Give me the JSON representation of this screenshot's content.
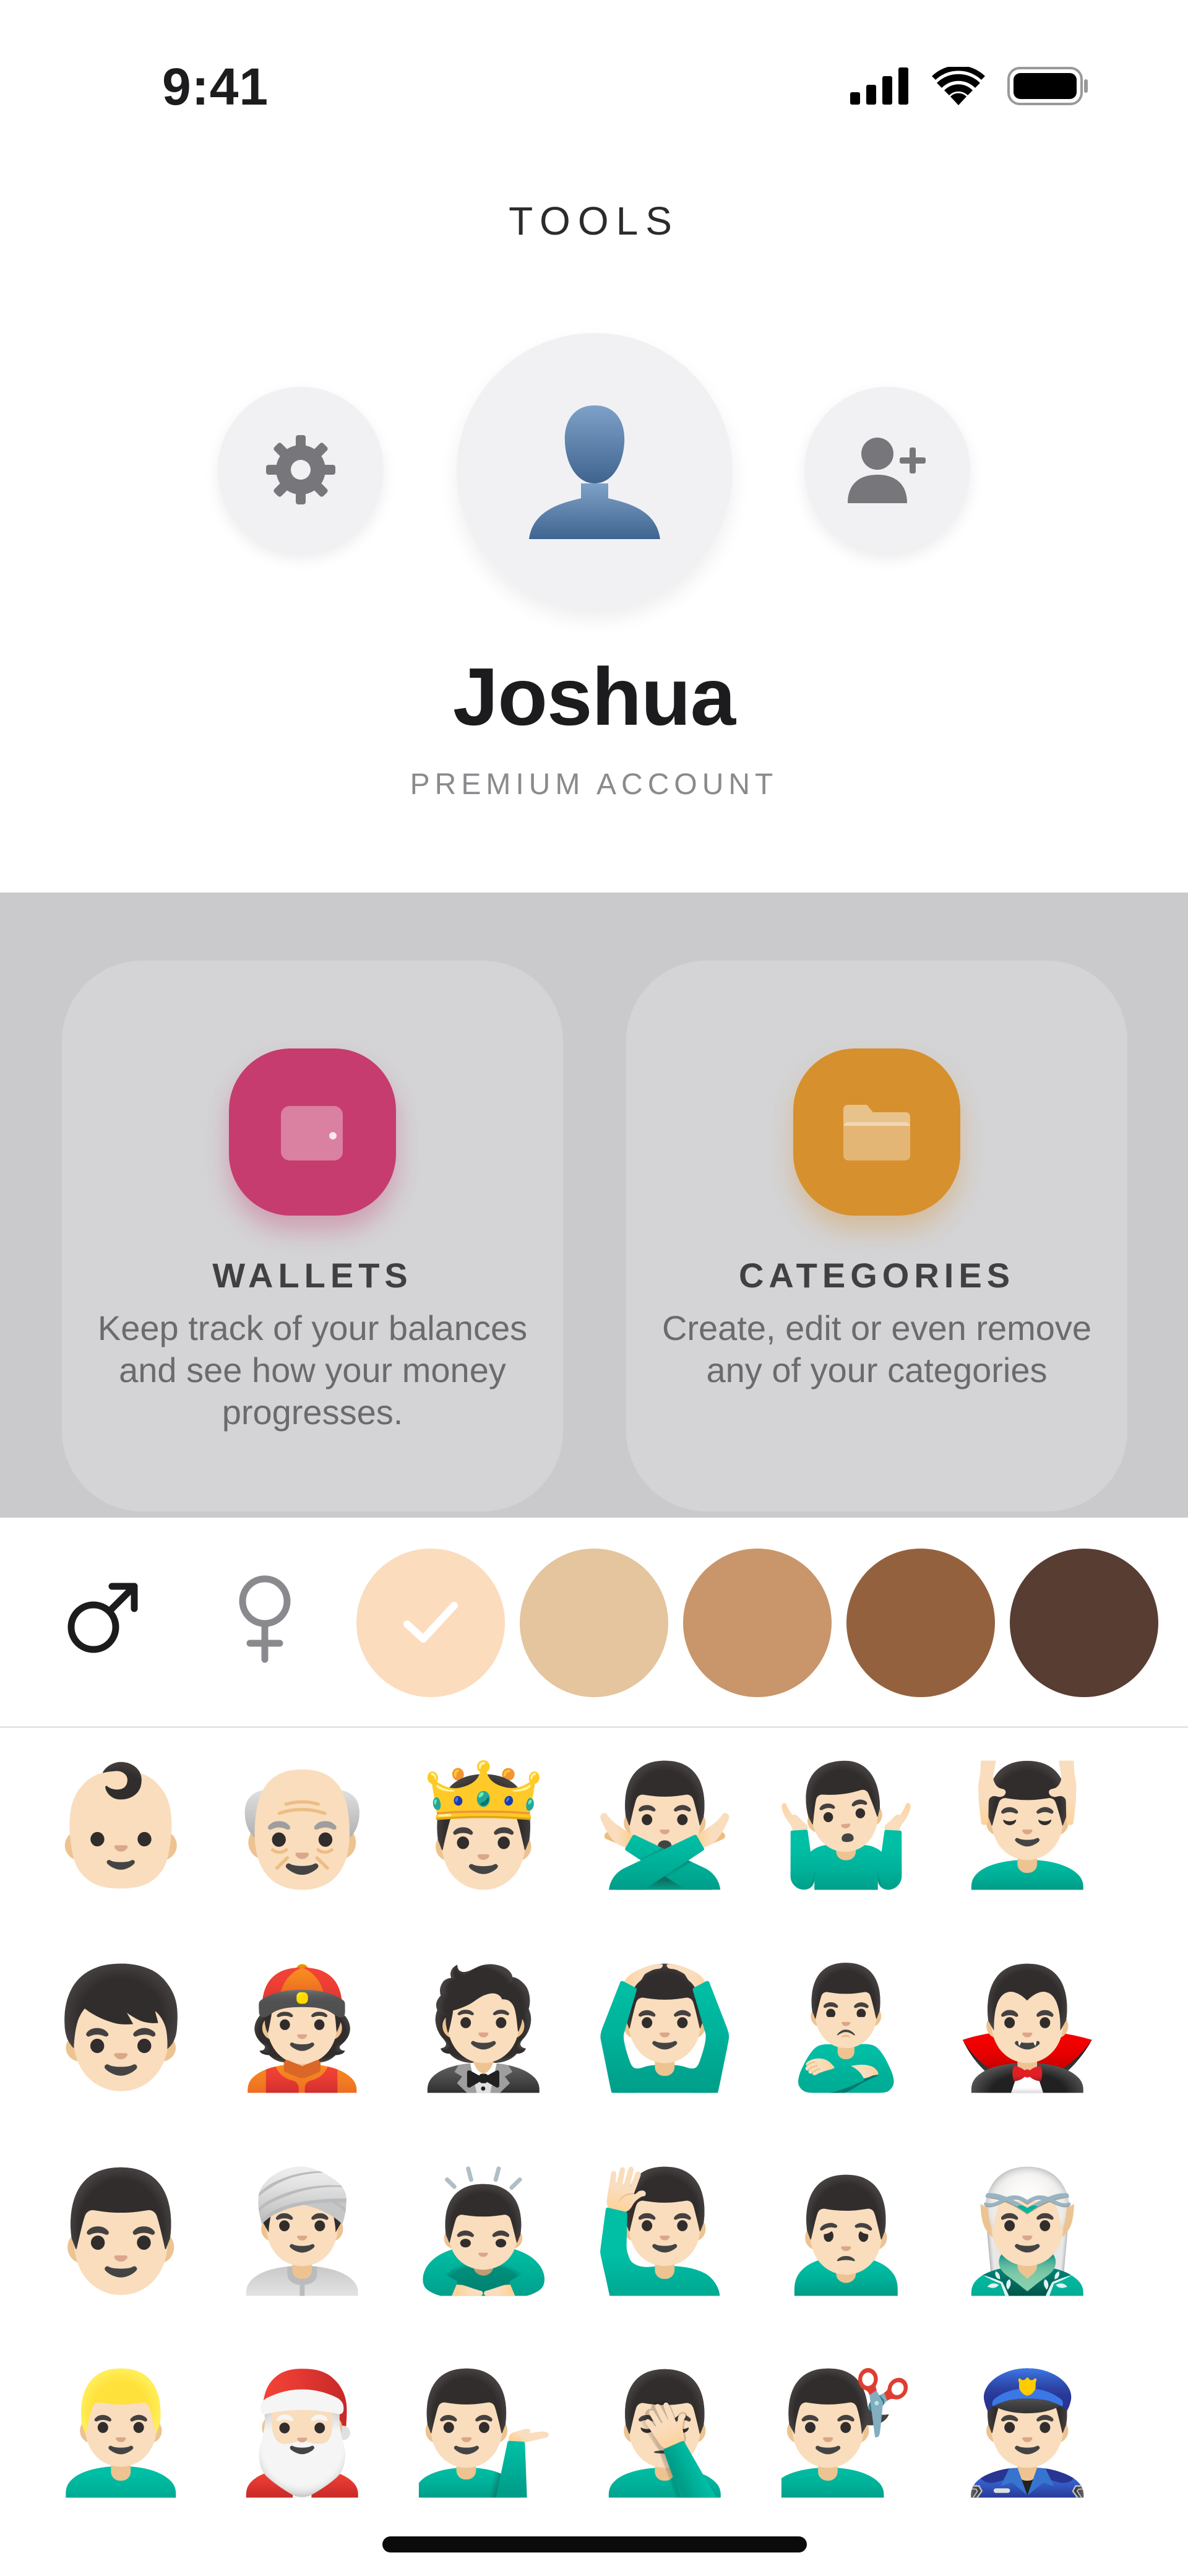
{
  "status_bar": {
    "time": "9:41",
    "icons": [
      "cellular-signal-icon",
      "wifi-icon",
      "battery-icon"
    ]
  },
  "header": {
    "title": "TOOLS",
    "buttons": [
      "settings-gear-icon",
      "avatar-person-icon",
      "add-user-icon"
    ]
  },
  "profile": {
    "name": "Joshua",
    "subtitle": "PREMIUM ACCOUNT"
  },
  "tools": {
    "wallets": {
      "title": "WALLETS",
      "description": "Keep track of your balances and see how your money progresses.",
      "icon": "wallet-icon",
      "color": "#c63c6e"
    },
    "categories": {
      "title": "CATEGORIES",
      "description": "Create, edit or even remove any of your categories",
      "icon": "folder-icon",
      "color": "#d6902d"
    }
  },
  "picker": {
    "genders": [
      "male-symbol-icon",
      "female-symbol-icon"
    ],
    "selected_gender": "male",
    "skin_tones": [
      "#fbdcbd",
      "#e4c59d",
      "#c9956a",
      "#94613f",
      "#583d33"
    ],
    "selected_skin_tone": "#fbdcbd",
    "emoji_rows": [
      [
        "👶🏻",
        "👴🏻",
        "🤴🏻",
        "🙅🏻‍♂️",
        "🤷🏻‍♂️",
        "💆🏻‍♂️"
      ],
      [
        "👦🏻",
        "👲🏻",
        "🤵🏻",
        "🙆🏻‍♂️",
        "🙎🏻‍♂️",
        "🧛🏻‍♂️"
      ],
      [
        "👨🏻",
        "👳🏻‍♂️",
        "🙇🏻‍♂️",
        "🙋🏻‍♂️",
        "🙍🏻‍♂️",
        "🧝🏻‍♂️"
      ],
      [
        "👱🏻‍♂️",
        "🎅🏻",
        "💁🏻‍♂️",
        "🤦🏻‍♂️",
        "💇🏻‍♂️",
        "👮🏻‍♂️"
      ]
    ]
  }
}
